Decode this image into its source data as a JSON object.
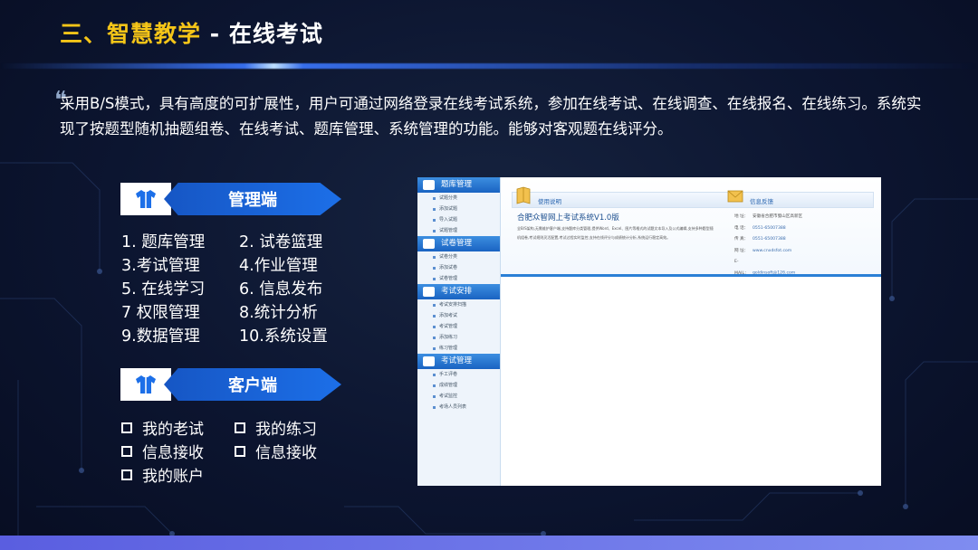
{
  "slide": {
    "title_main": "三、智慧教学",
    "title_dash": " - ",
    "title_sub": "在线考试",
    "intro": "采用B/S模式，具有高度的可扩展性，用户可通过网络登录在线考试系统，参加在线考试、在线调查、在线报名、在线练习。系统实现了按题型随机抽题组卷、在线考试、题库管理、系统管理的功能。能够对客观题在线评分。",
    "accent_color": "#f5c518",
    "banner_color": "#1c6fe8"
  },
  "admin": {
    "label": "管理端",
    "icon": "shirt-icon",
    "rows": [
      [
        "1. 题库管理",
        "2. 试卷篮理"
      ],
      [
        "3.考试管理",
        "4.作业管理"
      ],
      [
        "5. 在线学习",
        "6. 信息发布"
      ],
      [
        "7 权限管理",
        "8.统计分析"
      ],
      [
        "9.数据管理",
        "10.系统设置"
      ]
    ]
  },
  "client": {
    "label": "客户端",
    "icon": "shirt-icon",
    "rows": [
      [
        "我的老试",
        "我的练习"
      ],
      [
        "信息接收",
        "信息接收"
      ],
      [
        "我的账户"
      ]
    ]
  },
  "screenshot": {
    "sidebar": [
      {
        "heading": "题库管理",
        "items": [
          "试题分类",
          "添加试题",
          "导入试题",
          "试题管理"
        ]
      },
      {
        "heading": "试卷管理",
        "items": [
          "试卷分类",
          "添加试卷",
          "试卷管理"
        ]
      },
      {
        "heading": "考试安排",
        "items": [
          "考试安排扫描",
          "添加考试",
          "考试管理",
          "添加练习",
          "练习管理"
        ]
      },
      {
        "heading": "考试管理",
        "items": [
          "手工评卷",
          "成绩管理",
          "考试监控",
          "考场人员列表"
        ]
      }
    ],
    "tab_help": "使用说明",
    "tab_feedback": "信息反馈",
    "system_title": "合肥众智网上考试系统V1.0版",
    "system_desc": "全B/S架构,无需维护客户端,支持题库分类管理,提供Word、Excel、图片等格式的试题文本导入及公式编辑,支持多种题型随机组卷,考试规则灵活配置,考试过程实时监控,支持在线评分与成绩统计分析,系统运行稳定高效。",
    "contact": [
      {
        "label": "地 址：",
        "value": "安徽省合肥市蜀山区高新区"
      },
      {
        "label": "电 话：",
        "value": "0551-65007388"
      },
      {
        "label": "传 真：",
        "value": "0551-65007388"
      },
      {
        "label": "网 址：",
        "value": "www.cnxdsfot.com"
      },
      {
        "label": "E-MAIL：",
        "value": "goldinsoft@126.com"
      }
    ]
  }
}
